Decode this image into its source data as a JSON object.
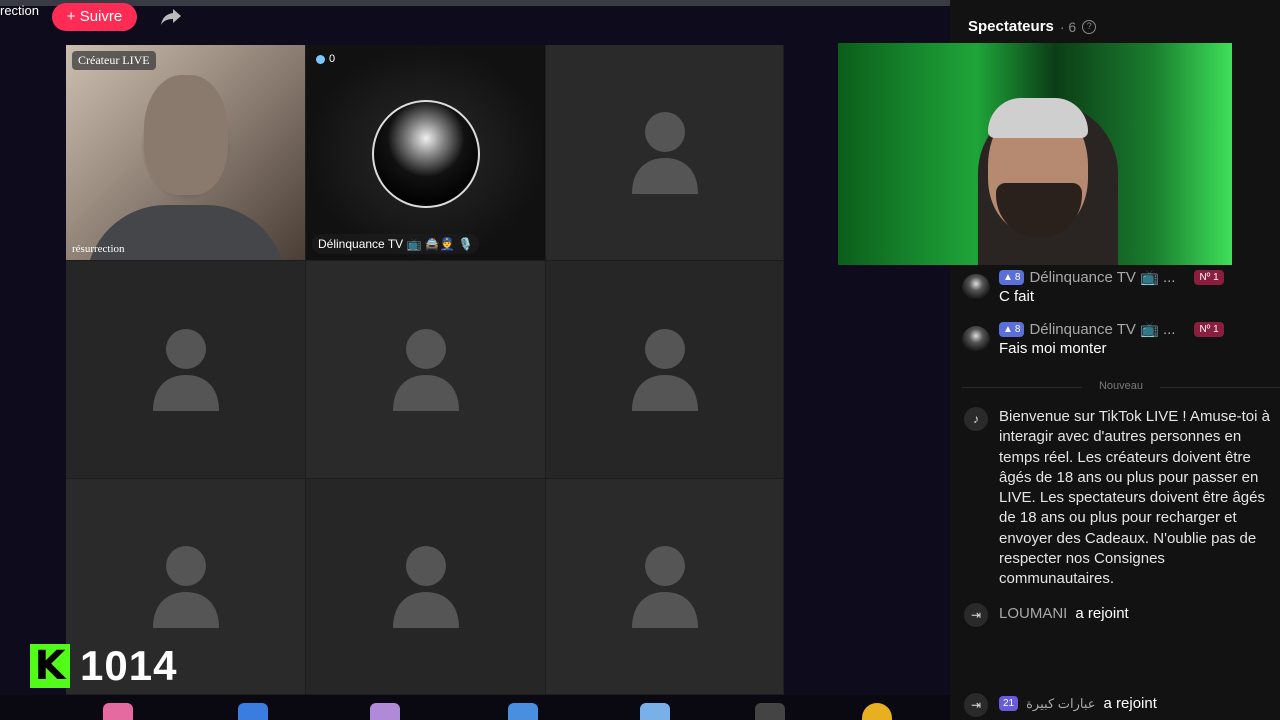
{
  "header": {
    "host_name": "rection",
    "follow_label": "+ Suivre"
  },
  "grid": {
    "cell1_badge": "Créateur LIVE",
    "cell1_label": "résurrection",
    "cell2_count": "0",
    "cell2_name": "Délinquance TV 📺 🚔👮 🎙️"
  },
  "kick": {
    "logo": "K",
    "count": "1014"
  },
  "spectators": {
    "title": "Spectateurs",
    "count": "· 6",
    "help": "?"
  },
  "chat": [
    {
      "level": "8",
      "name": "Délinquance TV 📺 ...",
      "rank": "Nº 1",
      "message": "C fait"
    },
    {
      "level": "8",
      "name": "Délinquance TV 📺 ...",
      "rank": "Nº 1",
      "message": "Fais moi monter"
    }
  ],
  "divider_label": "Nouveau",
  "welcome_text": "Bienvenue sur TikTok LIVE ! Amuse-toi à interagir avec d'autres personnes en temps réel. Les créateurs doivent être âgés de 18 ans ou plus pour passer en LIVE. Les spectateurs doivent être âgés de 18 ans ou plus pour recharger et envoyer des Cadeaux. N'oublie pas de respecter nos Consignes communautaires.",
  "joins": [
    {
      "name": "LOUMANI",
      "text": "a rejoint"
    },
    {
      "level": "21",
      "name": "عبارات كبيرة",
      "text": "a rejoint"
    }
  ],
  "colors": {
    "follow": "#fe2c55",
    "kick_green": "#53fc18",
    "level_badge": "#5a6fd8",
    "rank_badge": "#8b1e3f"
  }
}
